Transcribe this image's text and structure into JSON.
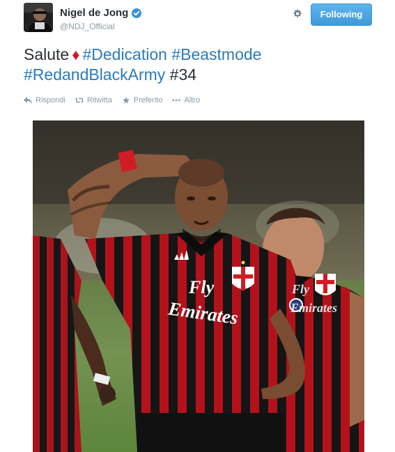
{
  "user": {
    "name": "Nigel de Jong",
    "handle": "@NDJ_Official",
    "verified": true
  },
  "follow_button": {
    "label": "Following"
  },
  "tweet": {
    "word": "Salute",
    "emoji": "♦",
    "hashtag_1": "#Dedication",
    "hashtag_2": "#Beastmode",
    "hashtag_3": "#RedandBlackArmy",
    "tail": "#34"
  },
  "actions": {
    "reply": "Rispondi",
    "retweet": "Ritwitta",
    "favorite": "Preferito",
    "more": "Altro"
  },
  "photo": {
    "shirt_text_1": "Fly",
    "shirt_text_2": "Emirates"
  },
  "colors": {
    "link": "#2b7bb9",
    "button": "#3d9ad8",
    "jersey_red": "#b3121b",
    "jersey_black": "#141414"
  }
}
